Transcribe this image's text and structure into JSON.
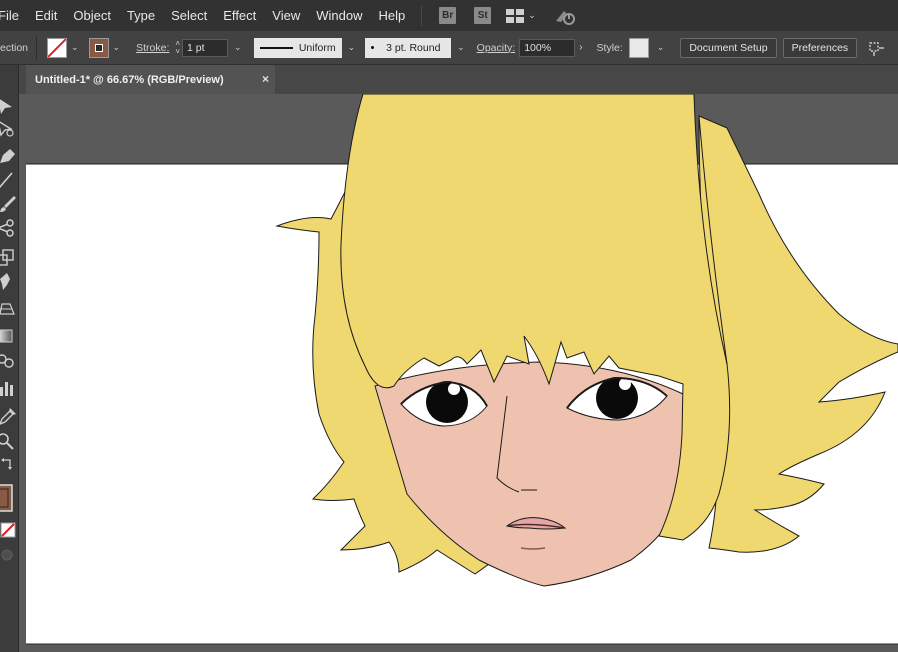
{
  "menu": {
    "items": [
      "File",
      "Edit",
      "Object",
      "Type",
      "Select",
      "Effect",
      "View",
      "Window",
      "Help"
    ],
    "bridge_badge": "Br",
    "stock_badge": "St"
  },
  "control": {
    "mode_label": "ection",
    "stroke_label": "Stroke:",
    "stroke_weight": "1 pt",
    "profile_label": "Uniform",
    "brush_label": "3 pt. Round",
    "opacity_label": "Opacity:",
    "opacity_value": "100%",
    "style_label": "Style:",
    "document_setup": "Document Setup",
    "preferences": "Preferences"
  },
  "document": {
    "tab_title": "Untitled-1* @ 66.67% (RGB/Preview)",
    "close_glyph": "×"
  },
  "colors": {
    "hair": "#F0D870",
    "skin": "#EEC2AE",
    "lip": "#E8A3A3",
    "fill_swatch": "#8B5A45",
    "canvas": "#FFFFFF",
    "pasteboard": "#5A5A5A"
  },
  "icons": [
    "arrange-documents-icon",
    "gpu-performance-icon",
    "selection-tool-icon",
    "direct-selection-icon",
    "pen-tool-icon",
    "line-tool-icon",
    "paintbrush-icon",
    "scissors-icon",
    "scale-tool-icon",
    "shape-builder-icon",
    "perspective-grid-icon",
    "gradient-icon",
    "blend-icon",
    "graph-icon",
    "eyedropper-icon",
    "zoom-icon",
    "swap-icon",
    "fill-stroke-icon",
    "none-icon",
    "draw-mode-icon"
  ]
}
